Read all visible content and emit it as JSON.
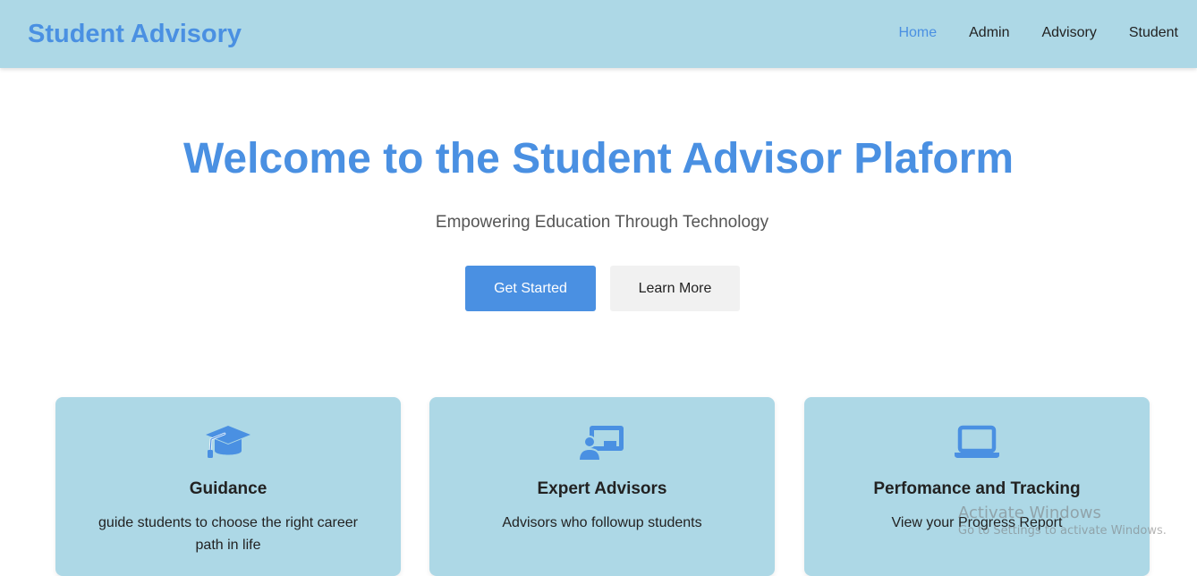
{
  "nav": {
    "brand": "Student Advisory",
    "links": [
      {
        "label": "Home",
        "active": true
      },
      {
        "label": "Admin"
      },
      {
        "label": "Advisory"
      },
      {
        "label": "Student"
      }
    ]
  },
  "hero": {
    "title": "Welcome to the Student Advisor Plaform",
    "subtitle": "Empowering Education Through Technology",
    "primary_button": "Get Started",
    "secondary_button": "Learn More"
  },
  "features": [
    {
      "icon": "graduation-cap-icon",
      "title": "Guidance",
      "text": "guide students to choose the right career path in life"
    },
    {
      "icon": "chalkboard-teacher-icon",
      "title": "Expert Advisors",
      "text": "Advisors who followup students"
    },
    {
      "icon": "laptop-icon",
      "title": "Perfomance and Tracking",
      "text": "View your Progress Report"
    }
  ],
  "watermark": {
    "title": "Activate Windows",
    "subtitle": "Go to Settings to activate Windows."
  },
  "colors": {
    "accent": "#4a90e2",
    "nav_bg": "#add8e6",
    "card_bg": "#add8e6",
    "secondary_button_bg": "#f1f1f1"
  }
}
